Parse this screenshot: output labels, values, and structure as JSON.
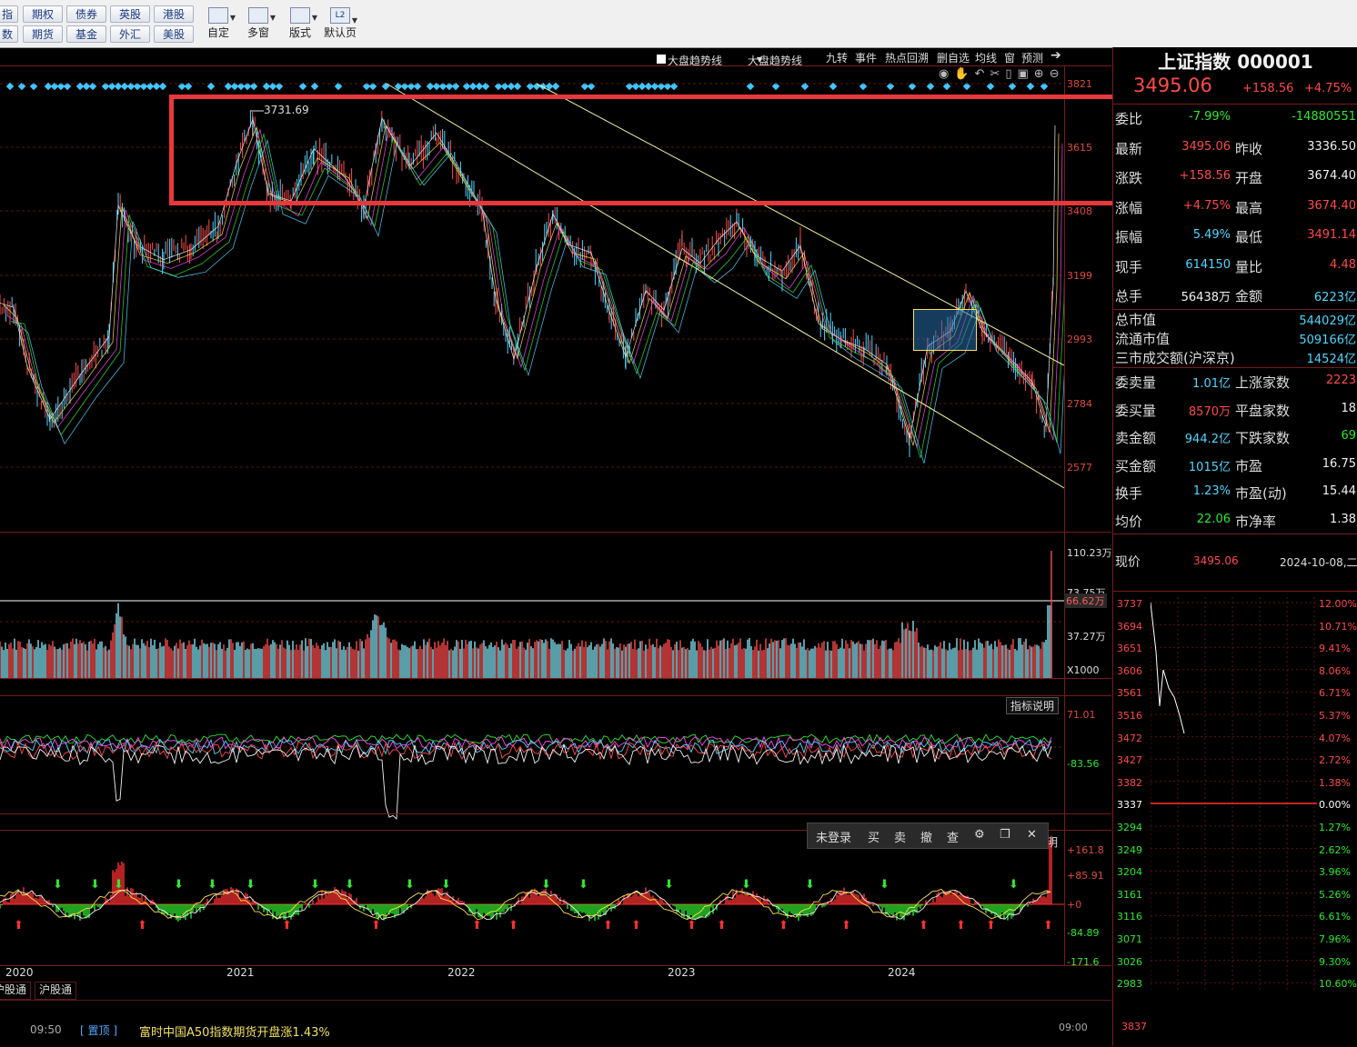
{
  "toolbar": {
    "row1": [
      "指",
      "期权",
      "债券",
      "英股",
      "港股"
    ],
    "row2": [
      "数",
      "期货",
      "基金",
      "外汇",
      "美股"
    ],
    "big_buttons": [
      "自定",
      "多窗",
      "版式",
      "默认页"
    ],
    "l2_label": "L2"
  },
  "chart_toolbar": {
    "checkbox_label": "大盘趋势线",
    "dropdown_label": "大盘趋势线",
    "items": [
      "九转",
      "事件",
      "热点回溯",
      "删自选",
      "均线",
      "窗",
      "预测"
    ]
  },
  "main_chart": {
    "peak_label": "3731.69",
    "y_ticks": [
      "3821",
      "3615",
      "3408",
      "3199",
      "2993",
      "2784",
      "2577"
    ],
    "x_labels": [
      "2020",
      "2021",
      "2022",
      "2023",
      "2024"
    ]
  },
  "volume_panel": {
    "y_ticks": [
      "110.23万",
      "73.75万",
      "66.62万",
      "37.27万",
      "X1000"
    ]
  },
  "indicator_panel": {
    "button": "指标说明",
    "y_ticks": [
      "71.01",
      "-83.56"
    ]
  },
  "macd_panel": {
    "y_ticks": [
      "+161.8",
      "+85.91",
      "+0",
      "-84.89",
      "-171.6"
    ],
    "clipped_label": "明"
  },
  "trade_bar": {
    "login": "未登录",
    "buy": "买",
    "sell": "卖",
    "cancel": "撤",
    "query": "查"
  },
  "bottom_tabs": [
    "沪股通",
    "沪股通"
  ],
  "news": [
    {
      "time": "09:50",
      "tag": "置顶",
      "text": "富时中国A50指数期货开盘涨1.43%"
    },
    {
      "time": "",
      "tag": "",
      "text": ""
    }
  ],
  "quote": {
    "title": "上证指数 000001",
    "price": "3495.06",
    "change": "+158.56",
    "pct": "+4.75%",
    "rows": [
      {
        "l": "委比",
        "v": "-7.99%",
        "l2": "",
        "v2": "-14880551",
        "c": "grn",
        "c2": "grn"
      },
      {
        "l": "最新",
        "v": "3495.06",
        "l2": "昨收",
        "v2": "3336.50",
        "c": "red",
        "c2": "wht"
      },
      {
        "l": "涨跌",
        "v": "+158.56",
        "l2": "开盘",
        "v2": "3674.40",
        "c": "red",
        "c2": "wht"
      },
      {
        "l": "涨幅",
        "v": "+4.75%",
        "l2": "最高",
        "v2": "3674.40",
        "c": "red",
        "c2": "red"
      },
      {
        "l": "振幅",
        "v": "5.49%",
        "l2": "最低",
        "v2": "3491.14",
        "c": "cyn",
        "c2": "red"
      },
      {
        "l": "现手",
        "v": "614150",
        "l2": "量比",
        "v2": "4.48",
        "c": "cyn",
        "c2": "red"
      },
      {
        "l": "总手",
        "v": "56438万",
        "l2": "金额",
        "v2": "6223亿",
        "c": "wht",
        "c2": "cyn"
      }
    ],
    "market": [
      {
        "l": "总市值",
        "v": "544029亿"
      },
      {
        "l": "流通市值",
        "v": "509166亿"
      },
      {
        "l": "三市成交额(沪深京)",
        "v": "14524亿"
      }
    ],
    "rows2": [
      {
        "l": "委卖量",
        "v": "1.01亿",
        "l2": "上涨家数",
        "v2": "2223",
        "c": "cyn",
        "c2": "red"
      },
      {
        "l": "委买量",
        "v": "8570万",
        "l2": "平盘家数",
        "v2": "18",
        "c": "red",
        "c2": "wht"
      },
      {
        "l": "卖金额",
        "v": "944.2亿",
        "l2": "下跌家数",
        "v2": "69",
        "c": "cyn",
        "c2": "grn"
      },
      {
        "l": "买金额",
        "v": "1015亿",
        "l2": "市盈",
        "v2": "16.75",
        "c": "cyn",
        "c2": "wht"
      },
      {
        "l": "换手",
        "v": "1.23%",
        "l2": "市盈(动)",
        "v2": "15.44",
        "c": "cyn",
        "c2": "wht"
      },
      {
        "l": "均价",
        "v": "22.06",
        "l2": "市净率",
        "v2": "1.38",
        "c": "grn",
        "c2": "wht"
      }
    ],
    "now": {
      "label": "现价",
      "value": "3495.06",
      "date": "2024-10-08,二"
    },
    "mini_left": [
      "3737",
      "3694",
      "3651",
      "3606",
      "3561",
      "3516",
      "3472",
      "3427",
      "3382",
      "3337",
      "3294",
      "3249",
      "3204",
      "3161",
      "3116",
      "3071",
      "3026",
      "2983"
    ],
    "mini_right": [
      "12.00%",
      "10.71%",
      "9.41%",
      "8.06%",
      "6.71%",
      "5.37%",
      "4.07%",
      "2.72%",
      "1.38%",
      "0.00%",
      "1.27%",
      "2.62%",
      "3.96%",
      "5.26%",
      "6.61%",
      "7.96%",
      "9.30%",
      "10.60%"
    ],
    "bottom_clip": "3837",
    "bottom_time": "09:00"
  },
  "colors": {
    "up": "#ff4a4a",
    "down": "#4fd6ff",
    "highlight": "#e8383d",
    "trend": "#f2f0a0"
  }
}
